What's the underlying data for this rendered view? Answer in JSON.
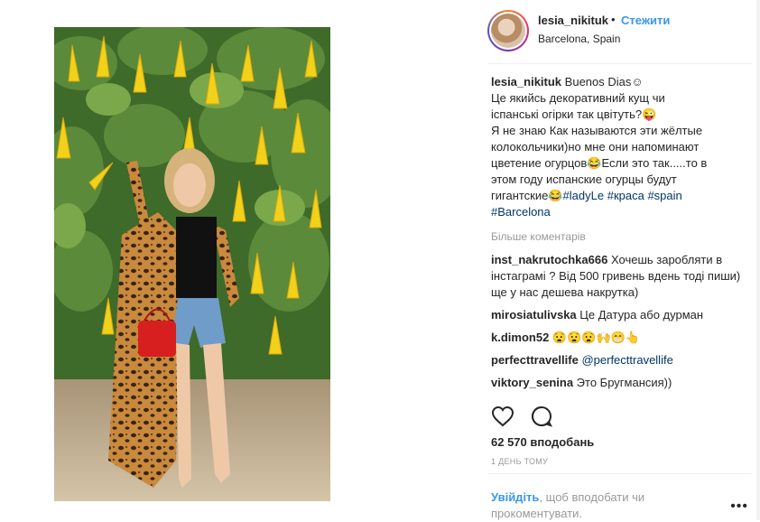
{
  "post": {
    "username": "lesia_nikituk",
    "dot": "•",
    "follow_label": "Стежити",
    "location": "Barcelona, Spain",
    "caption": {
      "user": "lesia_nikituk",
      "lines": [
        "Buenos Dias☺",
        "Це якийсь декоративний кущ чи",
        "іспанські огірки так цвітуть?😜",
        "Я не знаю Как называются эти жёлтые",
        "колокольчики)но мне они напоминают",
        "цветение огурцов😂Если это так.....то в",
        "этом году испанские огурцы будут",
        "гигантские😂"
      ],
      "hashtags": [
        "#ladyLe",
        "#краса",
        "#spain",
        "#Barcelona"
      ]
    },
    "more_comments_label": "Більше коментарів",
    "comments": [
      {
        "user": "inst_nakrutochka666",
        "text": "Хочешь заробляти в інстаграмі ? Від 500 гривень вдень тоді пиши) ще у нас дешева накрутка)"
      },
      {
        "user": "mirosiatulivska",
        "text": "Це Датура або дурман"
      },
      {
        "user": "k.dimon52",
        "text": "😧😧😧🙌😁👆"
      },
      {
        "user": "perfecttravellife",
        "mention": "@perfecttravellife"
      },
      {
        "user": "viktory_senina",
        "text": "Это Бругмансия))"
      }
    ],
    "likes": "62 570 вподобань",
    "time_ago": "1 ДЕНЬ ТОМУ",
    "login_link": "Увійдіть",
    "login_text": ", щоб вподобати чи прокоментувати.",
    "more_options_glyph": "•••"
  },
  "icons": {
    "like": "heart-icon",
    "comment": "comment-bubble-icon",
    "more": "more-options-icon"
  },
  "colors": {
    "link_blue": "#3897f0",
    "hashtag": "#003569",
    "muted": "#999999",
    "text": "#262626"
  }
}
